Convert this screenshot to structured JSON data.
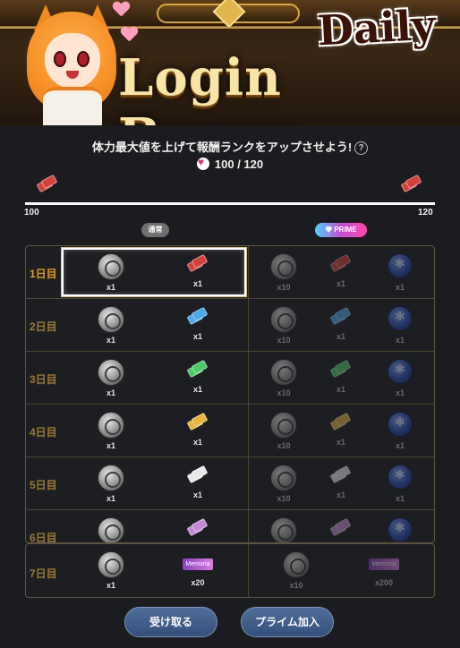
{
  "banner": {
    "title_top": "Daily",
    "title_main": "Login Bonus"
  },
  "info": {
    "message": "体力最大値を上げて報酬ランクをアップさせよう!",
    "help_symbol": "?",
    "stamina": "100 / 120",
    "track_min": "100",
    "track_max": "120"
  },
  "tabs": {
    "normal": "通常",
    "prime": "PRIME"
  },
  "colors": {
    "ticket_red": "#d4403a",
    "ticket_blue": "#4aa8e8",
    "ticket_green": "#4bc96a",
    "ticket_gold": "#e8b43a",
    "ticket_white": "#e8e8e8",
    "ticket_purple": "#c48ad8",
    "accent_day": "#e39b1c"
  },
  "days": [
    {
      "label": "1日目",
      "ticket": "#d4403a",
      "normal_coin": "x1",
      "normal_ticket": "x1",
      "prime_coin": "x10",
      "prime_ticket": "x1",
      "prime_orb": "x1"
    },
    {
      "label": "2日目",
      "ticket": "#4aa8e8",
      "normal_coin": "x1",
      "normal_ticket": "x1",
      "prime_coin": "x10",
      "prime_ticket": "x1",
      "prime_orb": "x1"
    },
    {
      "label": "3日目",
      "ticket": "#4bc96a",
      "normal_coin": "x1",
      "normal_ticket": "x1",
      "prime_coin": "x10",
      "prime_ticket": "x1",
      "prime_orb": "x1"
    },
    {
      "label": "4日目",
      "ticket": "#e8b43a",
      "normal_coin": "x1",
      "normal_ticket": "x1",
      "prime_coin": "x10",
      "prime_ticket": "x1",
      "prime_orb": "x1"
    },
    {
      "label": "5日目",
      "ticket": "#e8e8e8",
      "normal_coin": "x1",
      "normal_ticket": "x1",
      "prime_coin": "x10",
      "prime_ticket": "x1",
      "prime_orb": "x1"
    },
    {
      "label": "6日目",
      "ticket": "#c48ad8",
      "normal_coin": "",
      "normal_ticket": "",
      "prime_coin": "",
      "prime_ticket": "",
      "prime_orb": ""
    }
  ],
  "day7": {
    "label": "7日目",
    "memoria": "Memoria",
    "normal_coin": "x1",
    "normal_memoria": "x20",
    "prime_coin": "x10",
    "prime_memoria": "x200"
  },
  "buttons": {
    "claim": "受け取る",
    "prime_join": "プライム加入"
  }
}
